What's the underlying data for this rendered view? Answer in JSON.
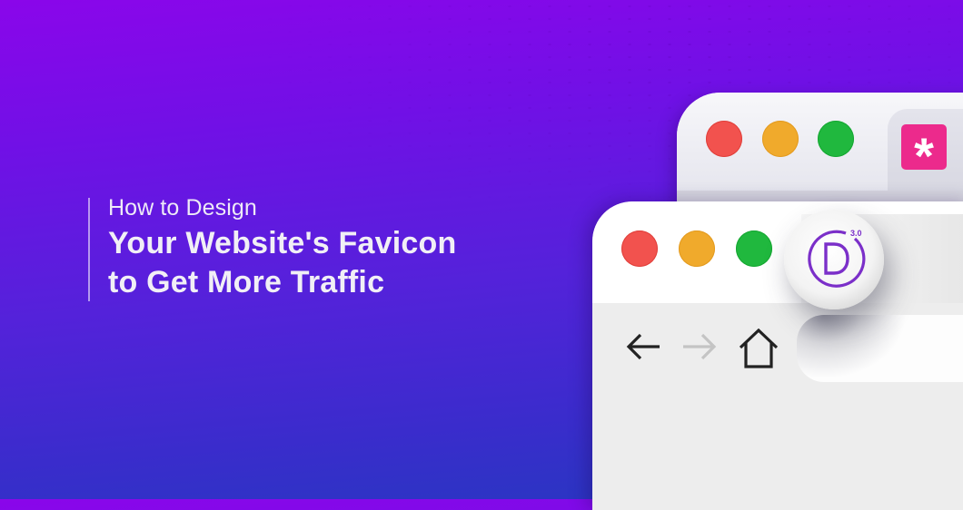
{
  "headline": {
    "kicker": "How to Design",
    "title_line_1": "Your Website's Favicon",
    "title_line_2": "to Get More Traffic"
  },
  "colors": {
    "background_top": "#8a06ea",
    "background_bottom": "#2638c0",
    "traffic_red": "#f2524e",
    "traffic_yellow": "#f0aa2c",
    "traffic_green": "#20b83e",
    "favicon_pink": "#ec2a8c",
    "divi_purple": "#7b2fc9"
  },
  "back_window": {
    "traffic_lights": [
      "close",
      "minimize",
      "maximize"
    ],
    "tab_favicon": {
      "icon": "asterisk-icon",
      "glyph": "*"
    }
  },
  "front_window": {
    "traffic_lights": [
      "close",
      "minimize",
      "maximize"
    ],
    "tab_favicon": {
      "icon": "divi-logo-icon",
      "letter": "D",
      "version": "3.0"
    },
    "nav": {
      "back": "arrow-left-icon",
      "forward": "arrow-right-icon",
      "home": "home-icon"
    },
    "address_bar": {
      "value": ""
    }
  }
}
